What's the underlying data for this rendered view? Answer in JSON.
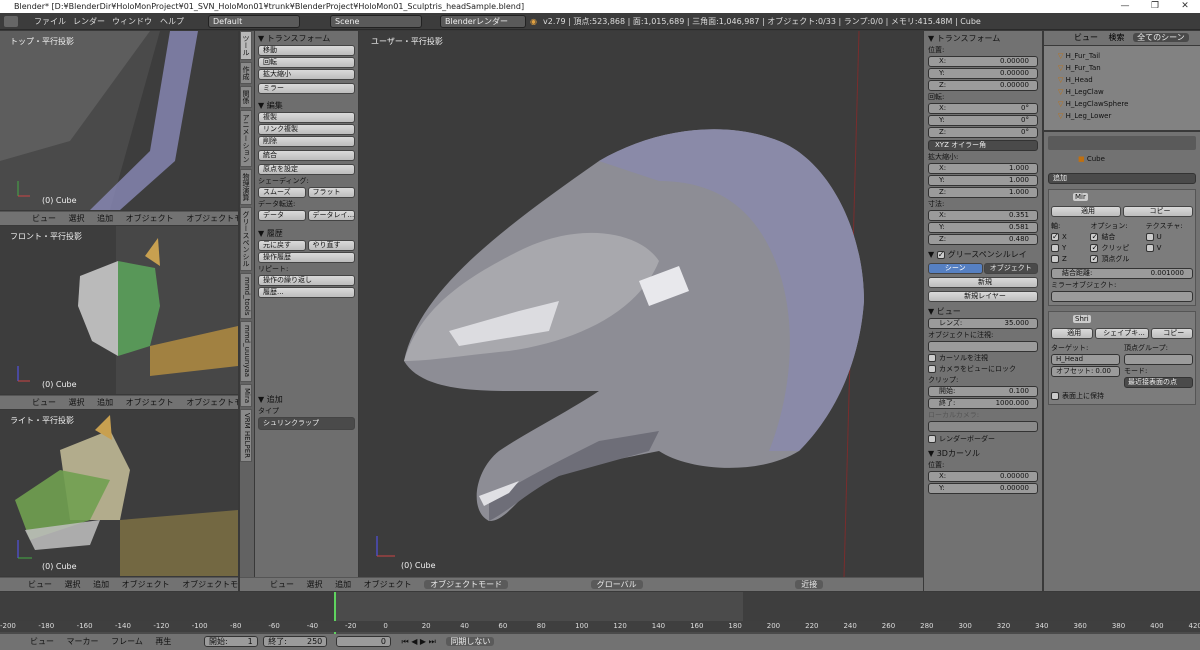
{
  "window": {
    "title": "Blender* [D:¥BlenderDir¥HoloMonProject¥01_SVN_HoloMon01¥trunk¥BlenderProject¥HoloMon01_Sculptris_headSample.blend]",
    "minimize": "—",
    "maximize": "❐",
    "close": "✕"
  },
  "infobar": {
    "menus": [
      "ファイル",
      "レンダー",
      "ウィンドウ",
      "ヘルプ"
    ],
    "layout": "Default",
    "scene": "Scene",
    "engine": "Blenderレンダー",
    "stats": "v2.79 | 頂点:523,868 | 面:1,015,689 | 三角面:1,046,987 | オブジェクト:0/33 | ランプ:0/0 | メモリ:415.48M | Cube"
  },
  "left_views": [
    {
      "name": "トップ・平行投影",
      "object": "(0) Cube"
    },
    {
      "name": "フロント・平行投影",
      "object": "(0) Cube"
    },
    {
      "name": "ライト・平行投影",
      "object": "(0) Cube"
    }
  ],
  "small_header": {
    "items": [
      "ビュー",
      "選択",
      "追加",
      "オブジェクト"
    ],
    "mode": "オブジェクトモー"
  },
  "tool_tabs": [
    "ツール",
    "作成",
    "関係",
    "アニメーション",
    "物理演算",
    "グリースペンシル",
    "mmd_tools",
    "mmd_uuunyaa",
    "Mira",
    "VRM HELPER"
  ],
  "tool_panel": {
    "transform": {
      "title": "トランスフォーム",
      "buttons": [
        "移動",
        "回転",
        "拡大縮小",
        "ミラー"
      ]
    },
    "edit": {
      "title": "編集",
      "buttons": [
        "複製",
        "リンク複製",
        "削除",
        "統合"
      ],
      "origin": "原点を設定"
    },
    "shading_label": "シェーディング:",
    "smooth": "スムーズ",
    "flat": "フラット",
    "data_transfer_label": "データ転送:",
    "data": "データ",
    "data_layer": "データレイ...",
    "history": {
      "title": "履歴",
      "undo": "元に戻す",
      "redo": "やり直す",
      "history_op": "操作履歴",
      "repeat_label": "リピート:",
      "repeat_last": "操作の繰り返し",
      "history": "履歴..."
    },
    "add": {
      "title": "追加",
      "type_label": "タイプ",
      "type_value": "シュリンクラップ"
    }
  },
  "main_view": {
    "name": "ユーザー・平行投影",
    "object": "(0) Cube"
  },
  "bottom_header": {
    "items": [
      "ビュー",
      "選択",
      "追加",
      "オブジェクト"
    ],
    "mode": "オブジェクトモード",
    "orientation": "グローバル",
    "snap": "近接"
  },
  "n_panel": {
    "transform_title": "トランスフォーム",
    "location_label": "位置:",
    "location": [
      {
        "k": "X:",
        "v": "0.00000"
      },
      {
        "k": "Y:",
        "v": "0.00000"
      },
      {
        "k": "Z:",
        "v": "0.00000"
      }
    ],
    "rotation_label": "回転:",
    "rotation": [
      {
        "k": "X:",
        "v": "0°"
      },
      {
        "k": "Y:",
        "v": "0°"
      },
      {
        "k": "Z:",
        "v": "0°"
      }
    ],
    "rot_mode": "XYZ オイラー角",
    "scale_label": "拡大縮小:",
    "scale": [
      {
        "k": "X:",
        "v": "1.000"
      },
      {
        "k": "Y:",
        "v": "1.000"
      },
      {
        "k": "Z:",
        "v": "1.000"
      }
    ],
    "dim_label": "寸法:",
    "dimensions": [
      {
        "k": "X:",
        "v": "0.351"
      },
      {
        "k": "Y:",
        "v": "0.581"
      },
      {
        "k": "Z:",
        "v": "0.480"
      }
    ],
    "grease_title": "グリースペンシルレイ",
    "scene_btn": "シーン",
    "object_btn": "オブジェクト",
    "new_btn": "新規",
    "new_layer_btn": "新規レイヤー",
    "view_title": "ビュー",
    "lens_label": "レンズ:",
    "lens_value": "35.000",
    "lock_to_object": "オブジェクトに注視:",
    "lock_cursor": "カーソルを注視",
    "lock_camera": "カメラをビューにロック",
    "clip_label": "クリップ:",
    "clip_start_label": "開始:",
    "clip_start": "0.100",
    "clip_end_label": "終了:",
    "clip_end": "1000.000",
    "local_camera": "ローカルカメラ:",
    "render_border": "レンダーボーダー",
    "cursor_title": "3Dカーソル",
    "cursor_loc_label": "位置:",
    "cursor": [
      {
        "k": "X:",
        "v": "0.00000"
      },
      {
        "k": "Y:",
        "v": "0.00000"
      }
    ]
  },
  "outliner": {
    "menus": [
      "ビュー",
      "検索"
    ],
    "scene_filter": "全てのシーン",
    "items": [
      "H_Fur_Tail",
      "H_Fur_Tan",
      "H_Head",
      "H_LegClaw",
      "H_LegClawSphere",
      "H_Leg_Lower"
    ]
  },
  "properties": {
    "breadcrumb": "Cube",
    "add_modifier": "追加",
    "mod1": {
      "name": "Mir",
      "apply": "適用",
      "copy": "コピー",
      "axis_label": "軸:",
      "options_label": "オプション:",
      "texture_label": "テクスチャ:",
      "axes": [
        "X",
        "Y",
        "Z"
      ],
      "options": [
        "結合",
        "クリッピ",
        "頂点グル"
      ],
      "tex": [
        "U",
        "V"
      ],
      "merge_label": "結合距離:",
      "merge_value": "0.001000",
      "mirror_obj_label": "ミラーオブジェクト:"
    },
    "mod2": {
      "name": "Shri",
      "apply": "適用",
      "shape": "シェイプキ...",
      "copy": "コピー",
      "target_label": "ターゲット:",
      "vgroup_label": "頂点グループ:",
      "target": "H_Head",
      "offset_label": "オフセット:",
      "offset": "0.00",
      "mode_label": "モード:",
      "mode": "最近接表面の点",
      "keep_above": "表面上に保持"
    }
  },
  "timeline": {
    "ticks": [
      "-200",
      "-180",
      "-160",
      "-140",
      "-120",
      "-100",
      "-80",
      "-60",
      "-40",
      "-20",
      "0",
      "20",
      "40",
      "60",
      "80",
      "100",
      "120",
      "140",
      "160",
      "180",
      "200",
      "220",
      "240",
      "260",
      "280",
      "300",
      "320",
      "340",
      "360",
      "380",
      "400",
      "420"
    ],
    "menus": [
      "ビュー",
      "マーカー",
      "フレーム",
      "再生"
    ],
    "start_label": "開始:",
    "start": "1",
    "end_label": "終了:",
    "end": "250",
    "current": "0",
    "sync": "同期しない"
  }
}
